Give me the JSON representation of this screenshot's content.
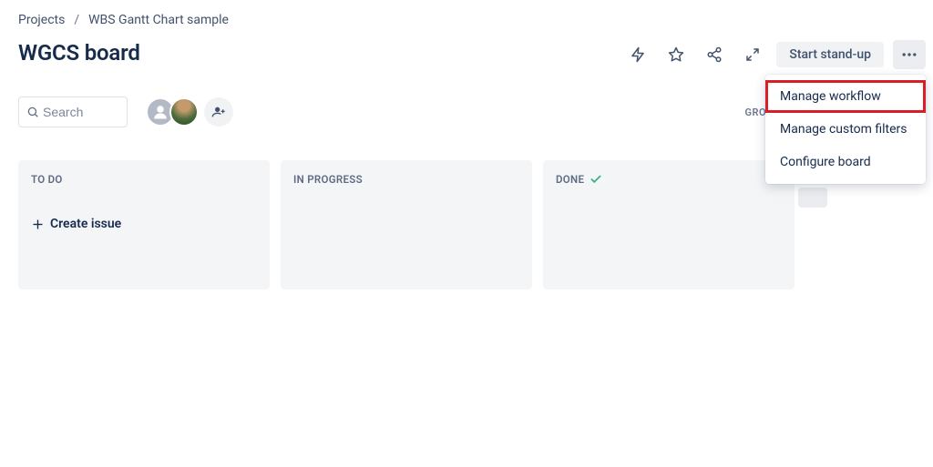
{
  "breadcrumb": {
    "root": "Projects",
    "project": "WBS Gantt Chart sample"
  },
  "page_title": "WGCS board",
  "toolbar": {
    "start_standup": "Start stand-up"
  },
  "search": {
    "placeholder": "Search"
  },
  "group_by_label": "GROUP BY",
  "dropdown": {
    "manage_workflow": "Manage workflow",
    "manage_filters": "Manage custom filters",
    "configure_board": "Configure board"
  },
  "columns": {
    "todo": "TO DO",
    "in_progress": "IN PROGRESS",
    "done": "DONE",
    "create_issue": "Create issue"
  }
}
